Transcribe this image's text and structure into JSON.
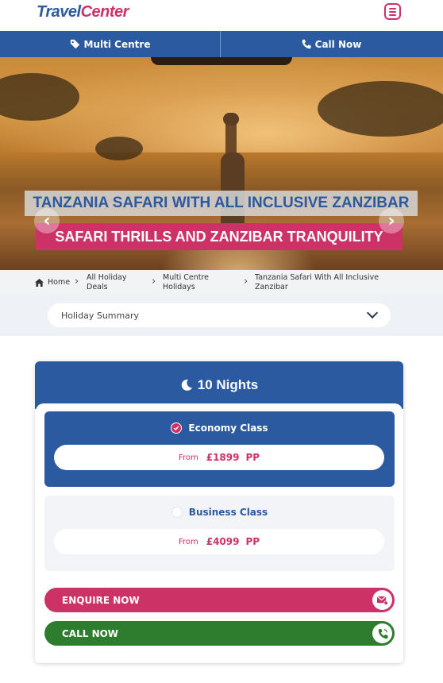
{
  "header": {
    "logo_part1": "Travel",
    "logo_part2": "Center",
    "menu_icon": "hamburger-menu-icon"
  },
  "actions": {
    "multi_centre_label": "Multi Centre",
    "multi_centre_icon": "tag-icon",
    "call_now_label": "Call Now",
    "call_now_icon": "phone-icon"
  },
  "hero": {
    "title": "TANZANIA SAFARI WITH ALL INCLUSIVE ZANZIBAR",
    "subtitle": "SAFARI THRILLS AND ZANZIBAR TRANQUILITY",
    "slide_count": 3,
    "active_slide": 1
  },
  "breadcrumb": {
    "items": [
      {
        "label": "Home",
        "icon": "home-icon"
      },
      {
        "label": "All Holiday Deals"
      },
      {
        "label": "Multi Centre Holidays"
      },
      {
        "label": "Tanzania Safari With All Inclusive Zanzibar"
      }
    ]
  },
  "summary": {
    "label": "Holiday Summary"
  },
  "package": {
    "nights_label": "10 Nights",
    "nights_icon": "moon-icon",
    "classes": [
      {
        "name": "Economy Class",
        "selected": true,
        "from_label": "From",
        "price": "£1899",
        "unit": "PP"
      },
      {
        "name": "Business Class",
        "selected": false,
        "from_label": "From",
        "price": "£4099",
        "unit": "PP"
      }
    ],
    "enquire_label": "ENQUIRE NOW",
    "enquire_icon": "envelope-icon",
    "call_label": "CALL NOW",
    "call_icon": "phone-ring-icon"
  },
  "colors": {
    "brand_blue": "#2c5aa0",
    "brand_pink": "#cc3266",
    "call_green": "#2e7d2e"
  }
}
